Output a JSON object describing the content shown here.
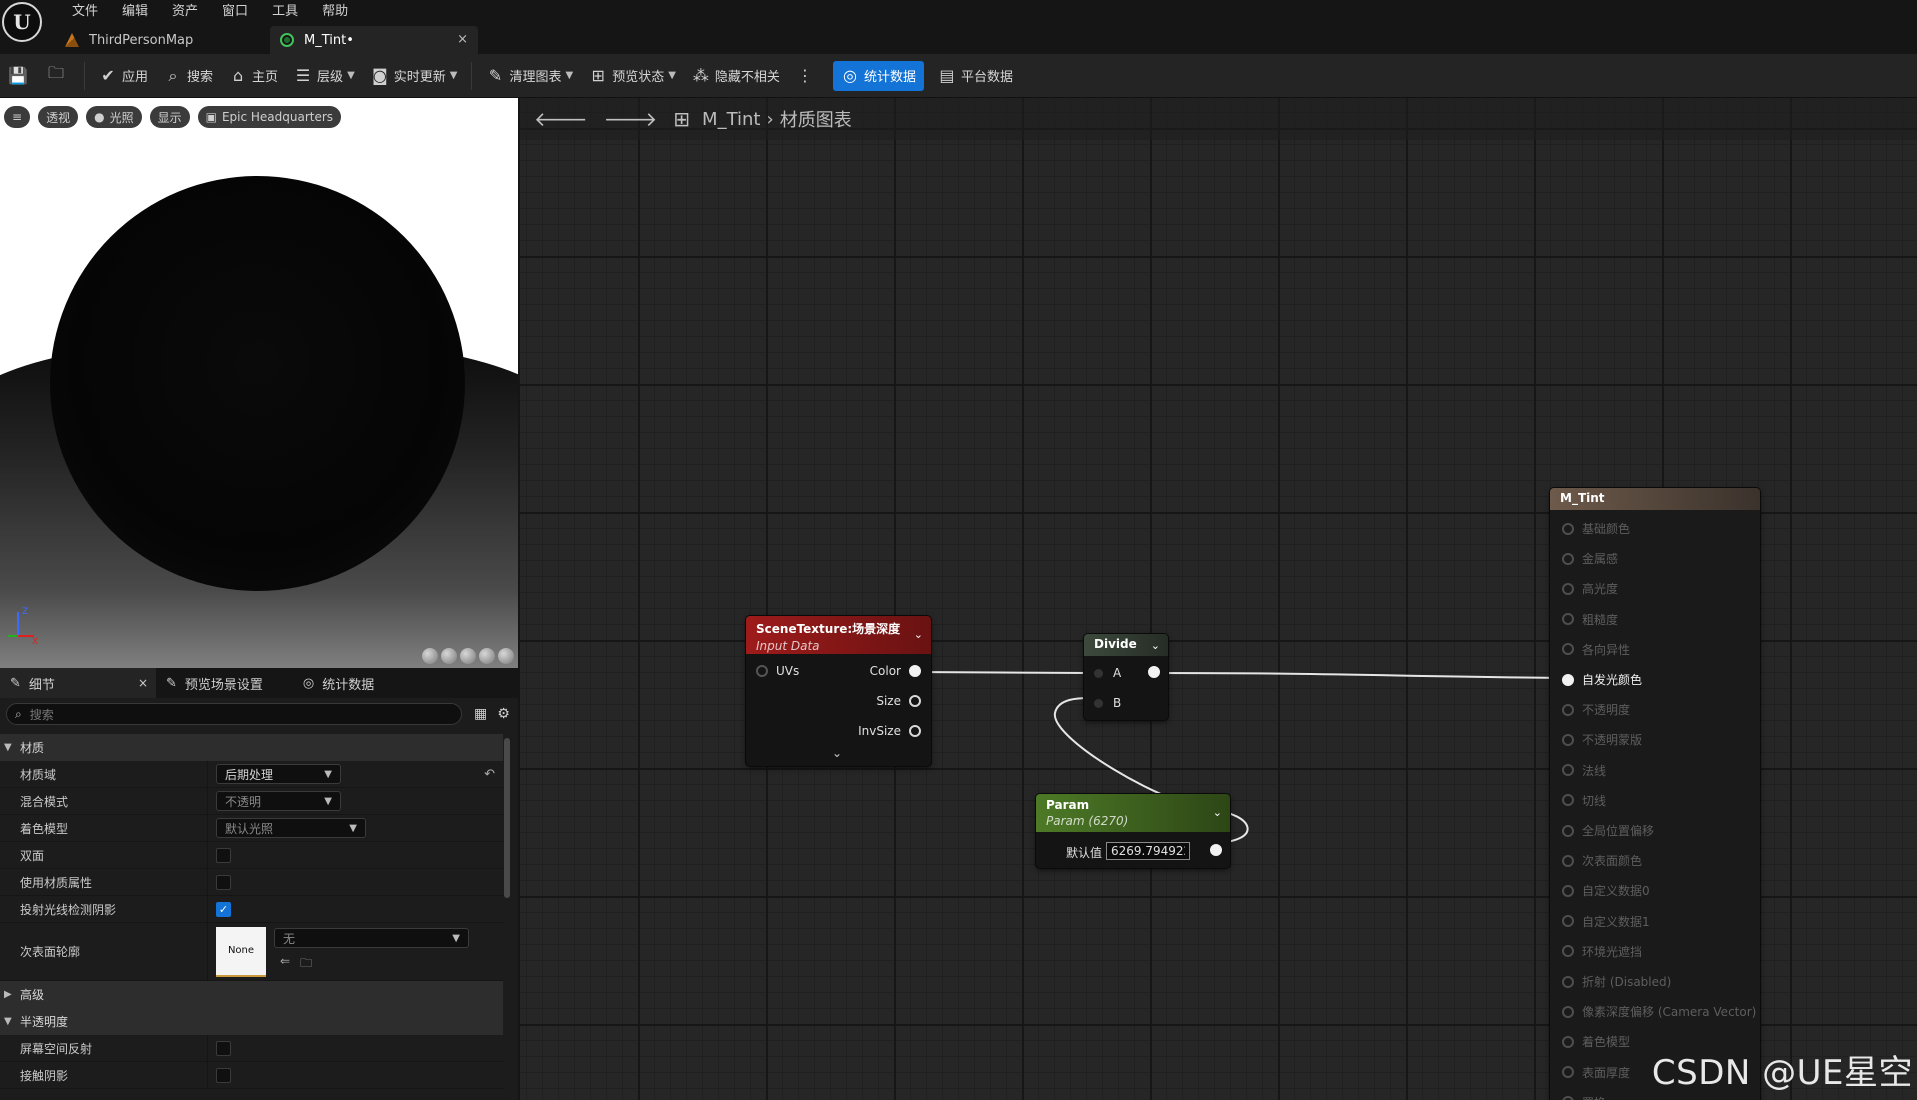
{
  "menu": [
    "文件",
    "编辑",
    "资产",
    "窗口",
    "工具",
    "帮助"
  ],
  "tabs": [
    {
      "label": "ThirdPersonMap"
    },
    {
      "label": "M_Tint•",
      "close": "×"
    }
  ],
  "toolbar": {
    "apply": "应用",
    "search": "搜索",
    "home": "主页",
    "hierarchy": "层级",
    "live_update": "实时更新",
    "clean_graph": "清理图表",
    "preview_state": "预览状态",
    "hide_unrelated": "隐藏不相关",
    "stats": "统计数据",
    "platform_stats": "平台数据"
  },
  "viewport": {
    "perspective": "透视",
    "lit": "光照",
    "show": "显示",
    "scene_name": "Epic Headquarters",
    "axis_z": "Z",
    "axis_x": "X"
  },
  "details": {
    "tabs": [
      {
        "label": "细节",
        "close": "×"
      },
      {
        "label": "预览场景设置"
      },
      {
        "label": "统计数据"
      }
    ],
    "search_placeholder": "搜索",
    "categories": {
      "material": "材质",
      "advanced": "高级",
      "translucency": "半透明度"
    },
    "rows": {
      "material_domain": {
        "name": "材质域",
        "value": "后期处理"
      },
      "blend_mode": {
        "name": "混合模式",
        "value": "不透明"
      },
      "shading_model": {
        "name": "着色模型",
        "value": "默认光照"
      },
      "two_sided": {
        "name": "双面"
      },
      "use_material_attributes": {
        "name": "使用材质属性"
      },
      "cast_ray_traced_shadows": {
        "name": "投射光线检测阴影",
        "checked": true
      },
      "subsurface_profile": {
        "name": "次表面轮廓",
        "thumb": "None",
        "value": "无"
      },
      "screen_space_reflections": {
        "name": "屏幕空间反射"
      },
      "contact_shadows": {
        "name": "接触阴影"
      }
    }
  },
  "graph": {
    "breadcrumb": [
      "M_Tint",
      "材质图表"
    ],
    "nodes": {
      "scene_texture": {
        "title": "SceneTexture:场景深度",
        "subtitle": "Input Data",
        "inputs": [
          "UVs"
        ],
        "outputs": [
          "Color",
          "Size",
          "InvSize"
        ]
      },
      "divide": {
        "title": "Divide",
        "inputs": [
          "A",
          "B"
        ]
      },
      "param": {
        "title": "Param",
        "subtitle": "Param (6270)",
        "default_label": "默认值",
        "default_value": "6269.794922"
      },
      "result": {
        "title": "M_Tint",
        "pins": [
          "基础颜色",
          "金属感",
          "高光度",
          "粗糙度",
          "各向异性",
          "自发光颜色",
          "不透明度",
          "不透明蒙版",
          "法线",
          "切线",
          "全局位置偏移",
          "次表面颜色",
          "自定义数据0",
          "自定义数据1",
          "环境光遮挡",
          "折射 (Disabled)",
          "像素深度偏移 (Camera Vector)",
          "着色模型",
          "表面厚度",
          "置换"
        ],
        "active_pin": "自发光颜色"
      }
    }
  },
  "watermark": "CSDN @UE星空"
}
